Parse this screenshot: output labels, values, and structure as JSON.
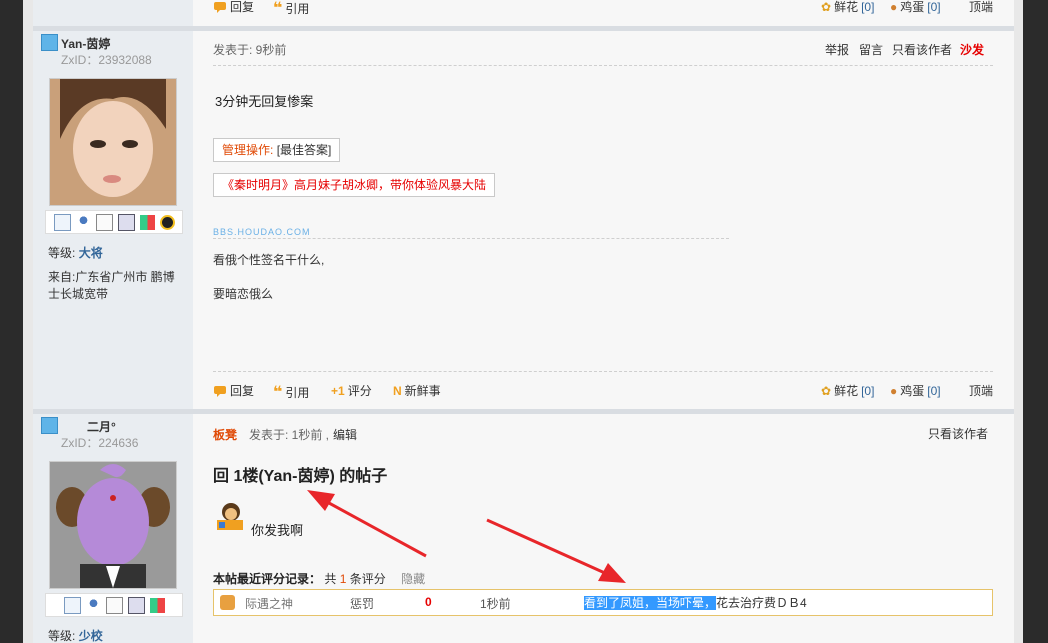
{
  "top_actions": {
    "reply": "回复",
    "quote": "引用",
    "flower": "鲜花",
    "flower_count": "[0]",
    "egg": "鸡蛋",
    "egg_count": "[0]",
    "top": "顶端"
  },
  "post1": {
    "username": "Yan-茵婷",
    "zxid_label": "ZxID：",
    "zxid": "23932088",
    "level_label": "等级:",
    "level": "大将",
    "from": "来自:广东省广州市 鹏博士长城宽带",
    "posted": "发表于: 9秒前",
    "header_links": {
      "report": "举报",
      "message": "留言",
      "only_author": "只看该作者",
      "floor": "沙发"
    },
    "content": "3分钟无回复惨案",
    "admin_label": "管理操作:",
    "admin_value": "[最佳答案]",
    "ad": "《秦时明月》高月妹子胡冰卿，带你体验风暴大陆",
    "watermark": "BBS.HOUDAO.COM",
    "sig1": "看俄个性签名干什么,",
    "sig2": "要暗恋俄么",
    "actions": {
      "reply": "回复",
      "quote": "引用",
      "rate": "评分",
      "news": "新鲜事",
      "flower": "鲜花",
      "flower_count": "[0]",
      "egg": "鸡蛋",
      "egg_count": "[0]",
      "top": "顶端"
    }
  },
  "post2": {
    "username": "二月°",
    "zxid_label": "ZxID：",
    "zxid": "224636",
    "level_label": "等级:",
    "level": "少校",
    "floor": "板凳",
    "posted": "发表于: 1秒前 ,",
    "edit": "编辑",
    "only_author": "只看该作者",
    "title": "回 1楼(Yan-茵婷) 的帖子",
    "content": "你发我啊",
    "rating_header": "本帖最近评分记录：",
    "rating_total_prefix": "共",
    "rating_total": "1",
    "rating_total_suffix": "条评分",
    "rating_hide": "隐藏",
    "rating_row": {
      "user": "际遇之神",
      "type": "惩罚",
      "value": "0",
      "time": "1秒前",
      "reason_highlight": "看到了凤姐，当场吓晕，",
      "reason_rest": "花去治疗费ＤＢ4"
    }
  },
  "colors": {
    "accent": "#e04a06",
    "link": "#336699",
    "highlight": "#3399ff"
  }
}
